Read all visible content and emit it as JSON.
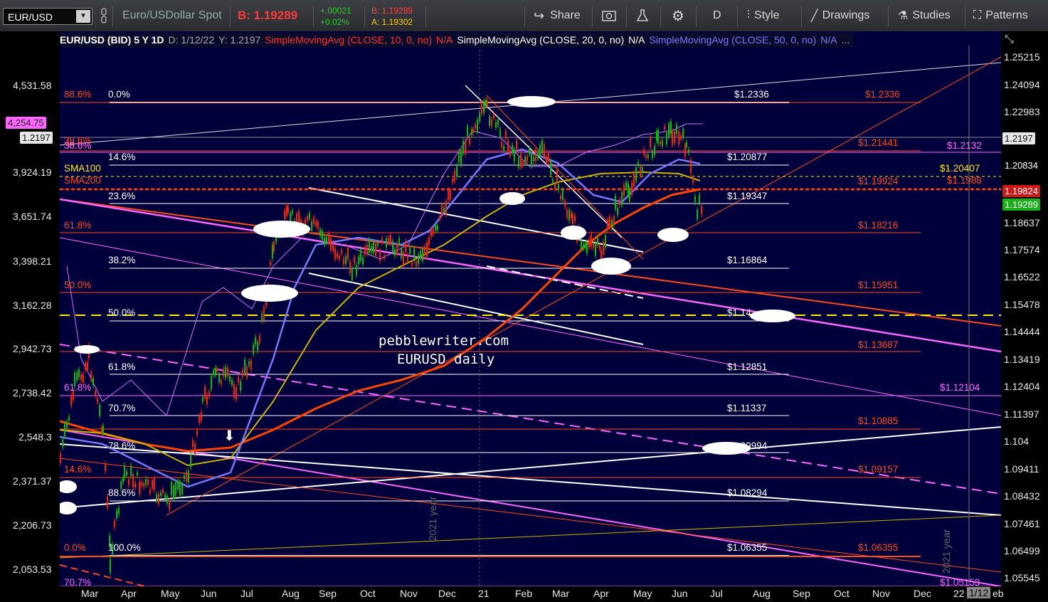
{
  "toolbar": {
    "symbol": "EUR/USD",
    "description": "Euro/USDollar Spot",
    "last_price": "B: 1.19289",
    "change": "+.00021",
    "change_pct": "+0.02%",
    "bid": "B: 1.19289",
    "ask": "A: 1.19302",
    "share": "Share",
    "interval": "D",
    "style": "Style",
    "drawings": "Drawings",
    "studies": "Studies",
    "patterns": "Patterns"
  },
  "study_bar": {
    "instrument": "EUR/USD (BID) 5 Y 1D",
    "date": "D: 1/12/22",
    "y_value": "Y: 1.2197",
    "sma10": "SimpleMovingAvg (CLOSE, 10, 0, no)",
    "sma20": "SimpleMovingAvg (CLOSE, 20, 0, no)",
    "sma50": "SimpleMovingAvg (CLOSE, 50, 0, no)",
    "na": "N/A",
    "more": "..."
  },
  "left_axis": [
    "4,531.58",
    "3,924.19",
    "3,651.74",
    "3,398.21",
    "3,162.28",
    "2,942.73",
    "2,738.42",
    "2,548.3",
    "2,371.37",
    "2,206.73",
    "2,053.53"
  ],
  "left_tags": {
    "pink": "4,254.75",
    "white": "1.2197"
  },
  "right_axis": [
    "1.25215",
    "1.24094",
    "1.22983",
    "1.20833",
    "1.18637",
    "1.17574",
    "1.16522",
    "1.15478",
    "1.14444",
    "1.13419",
    "1.12404",
    "1.11397",
    "1.104",
    "1.09411",
    "1.08432",
    "1.07461",
    "1.06499",
    "1.05545"
  ],
  "right_tags": {
    "current": "1.2197",
    "p1": "1.20834",
    "red": "1.19824",
    "green": "1.19289"
  },
  "months": [
    "Mar",
    "Apr",
    "May",
    "Jun",
    "Jul",
    "Aug",
    "Sep",
    "Oct",
    "Nov",
    "Dec",
    "21",
    "Feb",
    "Mar",
    "Apr",
    "May",
    "Jun",
    "Jul",
    "Aug",
    "Sep",
    "Oct",
    "Nov",
    "Dec",
    "22",
    "1/12",
    "eb"
  ],
  "fib_white_pct": [
    "0.0%",
    "14.6%",
    "23.6%",
    "38.2%",
    "50.0%",
    "61.8%",
    "70.7%",
    "78.6%",
    "88.6%",
    "100.0%"
  ],
  "fib_white_val": [
    "$1.2336",
    "$1.20877",
    "$1.19347",
    "$1.16864",
    "$1.14",
    "$1.12851",
    "$1.11337",
    "$1.09994",
    "$1.08294",
    "$1.06355"
  ],
  "fib_red_pct": [
    "88.6%",
    "50.0%",
    "61.8%",
    "50.0%",
    "0.0%",
    "14.6%",
    "38.6%"
  ],
  "fib_red_val": [
    "$1.2336",
    "$1.21441",
    "$1.19924",
    "$1.18216",
    "$1.15951",
    "$1.13687",
    "$1.10885",
    "$1.09157",
    "$1.06355"
  ],
  "fib_mag_pct": [
    "38.6%",
    "61.8%",
    "70.7%"
  ],
  "fib_mag_val": [
    "$1.2132",
    "$1.12104",
    "$1.05153"
  ],
  "sma_labels": {
    "sma100": "SMA100",
    "sma200": "SMA200",
    "v100": "$1.20407",
    "v200": "$1.1988"
  },
  "watermark": {
    "site": "pebblewriter.com",
    "title": "EURUSD daily"
  },
  "year_labels": [
    "2021 year",
    "2021 year"
  ],
  "colors": {
    "bg": "#00003a",
    "fib_white": "#ffffff",
    "fib_red": "#ff4a1c",
    "magenta": "#ff66ff",
    "sma50": "#7878ff",
    "sma100": "#c8b400",
    "sma200": "#ff4500",
    "green": "#00c000",
    "red": "#ff2000"
  },
  "icons": [
    "share-icon",
    "snapshot-icon",
    "flask-icon",
    "gear-icon",
    "style-icon",
    "pencil-icon",
    "studies-flask-icon",
    "patterns-icon",
    "cursor-icon"
  ]
}
